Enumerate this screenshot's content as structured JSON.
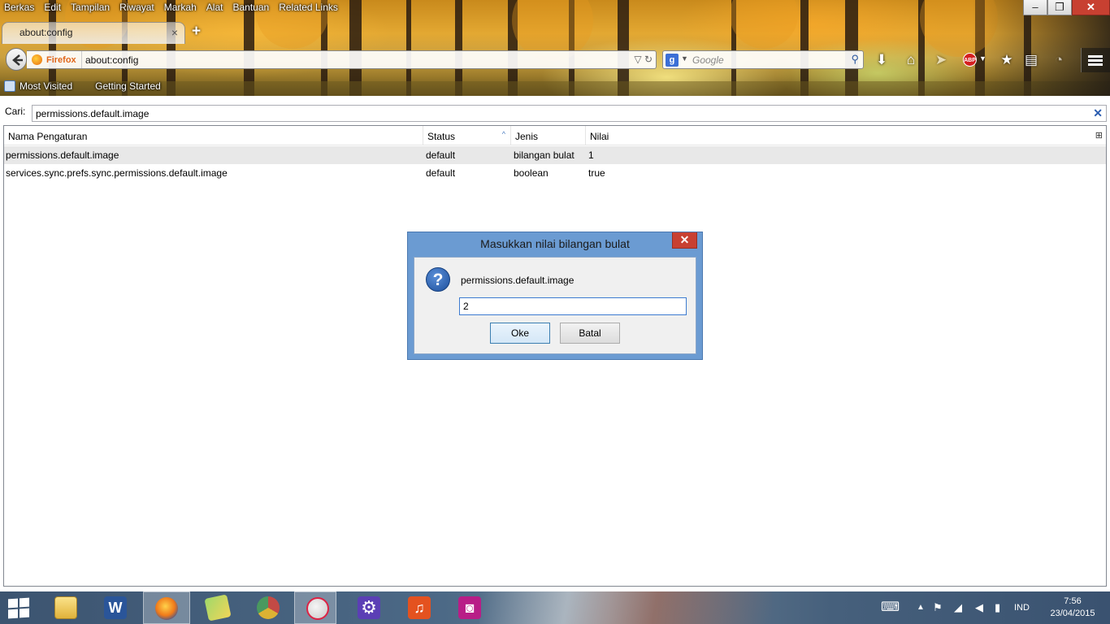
{
  "window": {
    "minimize": "–",
    "maximize": "❐",
    "close": "✕"
  },
  "menu": [
    "Berkas",
    "Edit",
    "Tampilan",
    "Riwayat",
    "Markah",
    "Alat",
    "Bantuan",
    "Related Links"
  ],
  "tab": {
    "title": "about:config",
    "close": "×",
    "new_tab": "+"
  },
  "navbar": {
    "identity_label": "Firefox",
    "url": "about:config",
    "search_placeholder": "Google",
    "url_icons": "▽ ↻"
  },
  "bookmarks": [
    "Most Visited",
    "Getting Started"
  ],
  "config": {
    "search_label": "Cari:",
    "search_value": "permissions.default.image",
    "clear": "✕",
    "columns": [
      "Nama Pengaturan",
      "Status",
      "Jenis",
      "Nilai"
    ],
    "sort_indicator": "^",
    "rows": [
      {
        "name": "permissions.default.image",
        "status": "default",
        "type": "bilangan bulat",
        "value": "1"
      },
      {
        "name": "services.sync.prefs.sync.permissions.default.image",
        "status": "default",
        "type": "boolean",
        "value": "true"
      }
    ]
  },
  "dialog": {
    "title": "Masukkan nilai bilangan bulat",
    "close": "✕",
    "icon": "?",
    "message": "permissions.default.image",
    "value": "2",
    "ok": "Oke",
    "cancel": "Batal"
  },
  "taskbar": {
    "apps": [
      "file-explorer",
      "word",
      "firefox",
      "folder-app",
      "chrome",
      "paint",
      "settings",
      "music",
      "camera"
    ],
    "active": "firefox"
  },
  "tray": {
    "language": "IND",
    "time": "7:56",
    "date": "23/04/2015"
  },
  "colors": {
    "accent": "#6b9bd2",
    "close_red": "#c84031",
    "firefox_orange": "#e0671b"
  }
}
